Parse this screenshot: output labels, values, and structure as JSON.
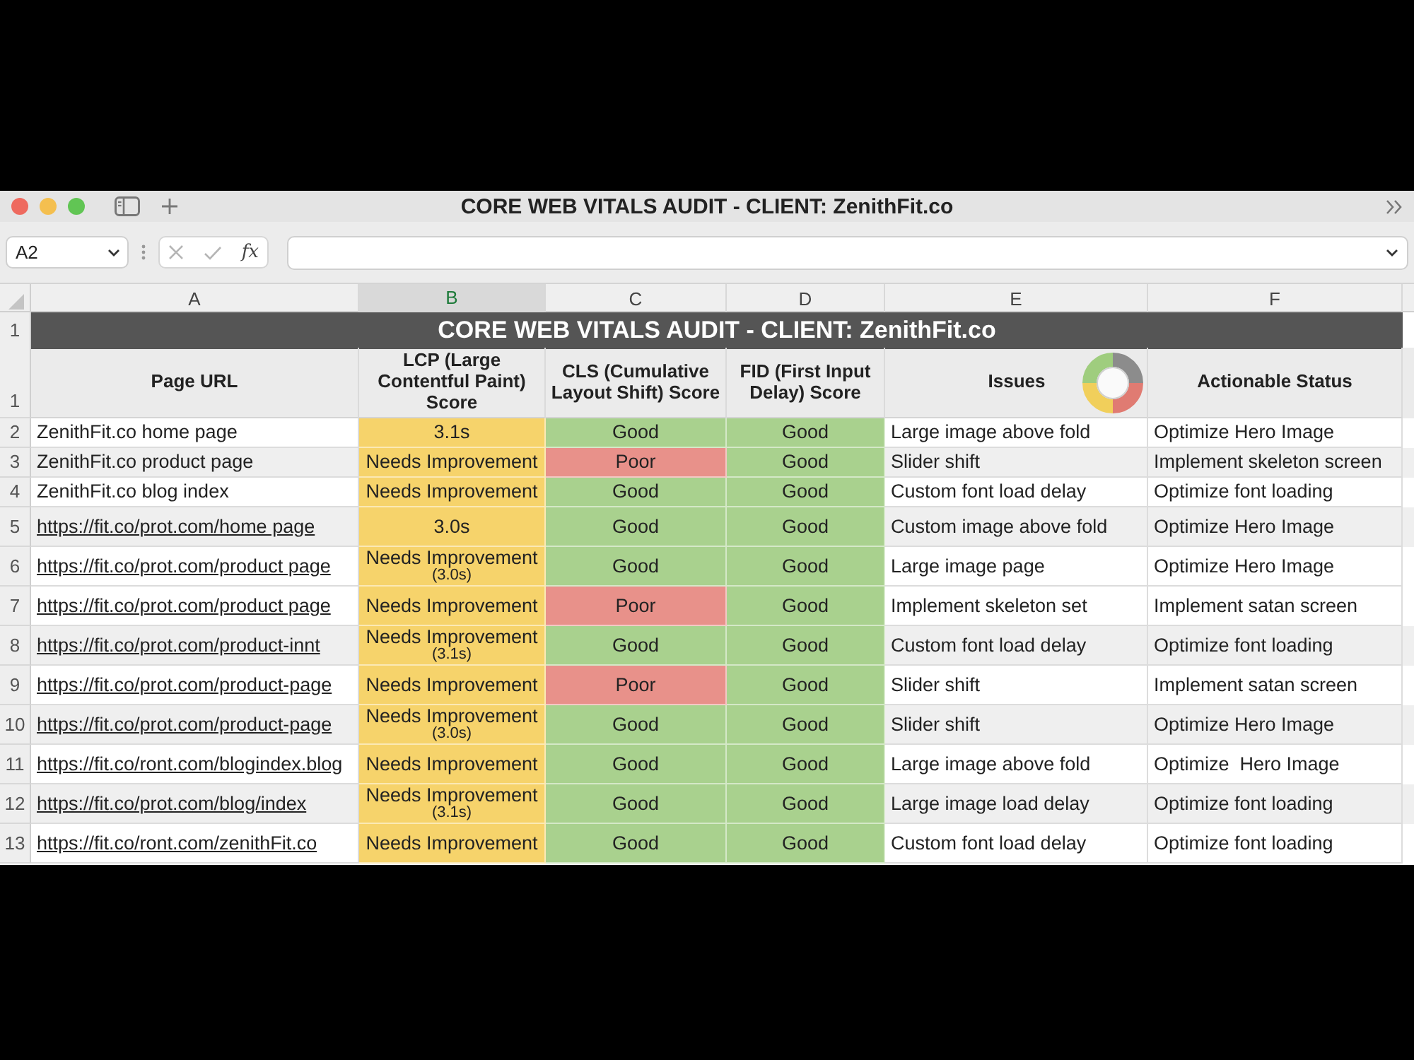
{
  "window": {
    "title": "CORE WEB VITALS AUDIT - CLIENT: ZenithFit.co"
  },
  "formula_bar": {
    "name_box": "A2",
    "function_button": "fx"
  },
  "column_headers": [
    {
      "label": "A",
      "selected": false
    },
    {
      "label": "B",
      "selected": true
    },
    {
      "label": "C",
      "selected": false
    },
    {
      "label": "D",
      "selected": false
    },
    {
      "label": "E",
      "selected": false
    },
    {
      "label": "F",
      "selected": false
    }
  ],
  "sheet": {
    "title_row": {
      "row_number": "1",
      "text": "CORE WEB VITALS AUDIT - CLIENT: ZenithFit.co"
    },
    "header_row": {
      "row_number": "1",
      "columns": [
        {
          "label": "Page URL",
          "has_legend": false
        },
        {
          "label": "LCP (Large Contentful Paint) Score",
          "has_legend": false
        },
        {
          "label": "CLS (Cumulative Layout Shift) Score",
          "has_legend": false
        },
        {
          "label": "FID (First Input Delay) Score",
          "has_legend": false
        },
        {
          "label": "Issues",
          "has_legend": true
        },
        {
          "label": "Actionable Status",
          "has_legend": false
        }
      ]
    },
    "rows": [
      {
        "row_number": "2",
        "shaded": false,
        "url": {
          "text": "ZenithFit.co home page",
          "link": false
        },
        "lcp": {
          "text": "3.1s",
          "color": "#f6d36b"
        },
        "cls": {
          "text": "Good",
          "color": "#a9d18e"
        },
        "fid": {
          "text": "Good",
          "color": "#a9d18e"
        },
        "issue": "Large image above fold",
        "status": "Optimize Hero Image"
      },
      {
        "row_number": "3",
        "shaded": true,
        "url": {
          "text": "ZenithFit.co product page",
          "link": false
        },
        "lcp": {
          "text": "Needs Improvement",
          "color": "#f6d36b"
        },
        "cls": {
          "text": "Poor",
          "color": "#e8918a"
        },
        "fid": {
          "text": "Good",
          "color": "#a9d18e"
        },
        "issue": "Slider shift",
        "status": "Implement skeleton screen"
      },
      {
        "row_number": "4",
        "shaded": false,
        "url": {
          "text": "ZenithFit.co blog index",
          "link": false
        },
        "lcp": {
          "text": "Needs Improvement",
          "color": "#f6d36b"
        },
        "cls": {
          "text": "Good",
          "color": "#a9d18e"
        },
        "fid": {
          "text": "Good",
          "color": "#a9d18e"
        },
        "issue": "Custom font load delay",
        "status": "Optimize font loading"
      },
      {
        "row_number": "5",
        "shaded": true,
        "url": {
          "text": "https://fit.co/prot.com/home page",
          "link": true
        },
        "lcp": {
          "text": "3.0s",
          "color": "#f6d36b"
        },
        "cls": {
          "text": "Good",
          "color": "#a9d18e"
        },
        "fid": {
          "text": "Good",
          "color": "#a9d18e"
        },
        "issue": "Custom image above fold",
        "status": "Optimize Hero Image"
      },
      {
        "row_number": "6",
        "shaded": false,
        "url": {
          "text": "https://fit.co/prot.com/product page",
          "link": true
        },
        "lcp": {
          "text": "Needs Improvement",
          "note": "(3.0s)",
          "color": "#f6d36b"
        },
        "cls": {
          "text": "Good",
          "color": "#a9d18e"
        },
        "fid": {
          "text": "Good",
          "color": "#a9d18e"
        },
        "issue": "Large image page",
        "status": "Optimize Hero Image"
      },
      {
        "row_number": "7",
        "shaded": false,
        "url": {
          "text": "https://fit.co/prot.com/product page",
          "link": true
        },
        "lcp": {
          "text": "Needs Improvement",
          "color": "#f6d36b"
        },
        "cls": {
          "text": "Poor",
          "color": "#e8918a"
        },
        "fid": {
          "text": "Good",
          "color": "#a9d18e"
        },
        "issue": "Implement skeleton set",
        "status": "Implement satan screen"
      },
      {
        "row_number": "8",
        "shaded": true,
        "url": {
          "text": "https://fit.co/prot.com/product-innt",
          "link": true
        },
        "lcp": {
          "text": "Needs Improvement",
          "note": "(3.1s)",
          "color": "#f6d36b"
        },
        "cls": {
          "text": "Good",
          "color": "#a9d18e"
        },
        "fid": {
          "text": "Good",
          "color": "#a9d18e"
        },
        "issue": "Custom font load delay",
        "status": "Optimize font loading"
      },
      {
        "row_number": "9",
        "shaded": false,
        "url": {
          "text": "https://fit.co/prot.com/product-page",
          "link": true
        },
        "lcp": {
          "text": "Needs Improvement",
          "color": "#f6d36b"
        },
        "cls": {
          "text": "Poor",
          "color": "#e8918a"
        },
        "fid": {
          "text": "Good",
          "color": "#a9d18e"
        },
        "issue": "Slider shift",
        "status": "Implement satan screen"
      },
      {
        "row_number": "10",
        "shaded": true,
        "url": {
          "text": "https://fit.co/prot.com/product-page",
          "link": true
        },
        "lcp": {
          "text": "Needs Improvement",
          "note": "(3.0s)",
          "color": "#f6d36b"
        },
        "cls": {
          "text": "Good",
          "color": "#a9d18e"
        },
        "fid": {
          "text": "Good",
          "color": "#a9d18e"
        },
        "issue": "Slider shift",
        "status": "Optimize Hero Image"
      },
      {
        "row_number": "11",
        "shaded": false,
        "url": {
          "text": "https://fit.co/ront.com/blogindex.blog",
          "link": true
        },
        "lcp": {
          "text": "Needs Improvement",
          "color": "#f6d36b"
        },
        "cls": {
          "text": "Good",
          "color": "#a9d18e"
        },
        "fid": {
          "text": "Good",
          "color": "#a9d18e"
        },
        "issue": "Large image above fold",
        "status": "Optimize  Hero Image"
      },
      {
        "row_number": "12",
        "shaded": true,
        "url": {
          "text": "https://fit.co/prot.com/blog/index",
          "link": true
        },
        "lcp": {
          "text": "Needs Improvement",
          "note": "(3.1s)",
          "color": "#f6d36b"
        },
        "cls": {
          "text": "Good",
          "color": "#a9d18e"
        },
        "fid": {
          "text": "Good",
          "color": "#a9d18e"
        },
        "issue": "Large image load delay",
        "status": "Optimize font loading"
      },
      {
        "row_number": "13",
        "shaded": false,
        "url": {
          "text": "https://fit.co/ront.com/zenithFit.co",
          "link": true
        },
        "lcp": {
          "text": "Needs Improvement",
          "color": "#f6d36b"
        },
        "cls": {
          "text": "Good",
          "color": "#a9d18e"
        },
        "fid": {
          "text": "Good",
          "color": "#a9d18e"
        },
        "issue": "Custom font load delay",
        "status": "Optimize font loading"
      }
    ]
  }
}
